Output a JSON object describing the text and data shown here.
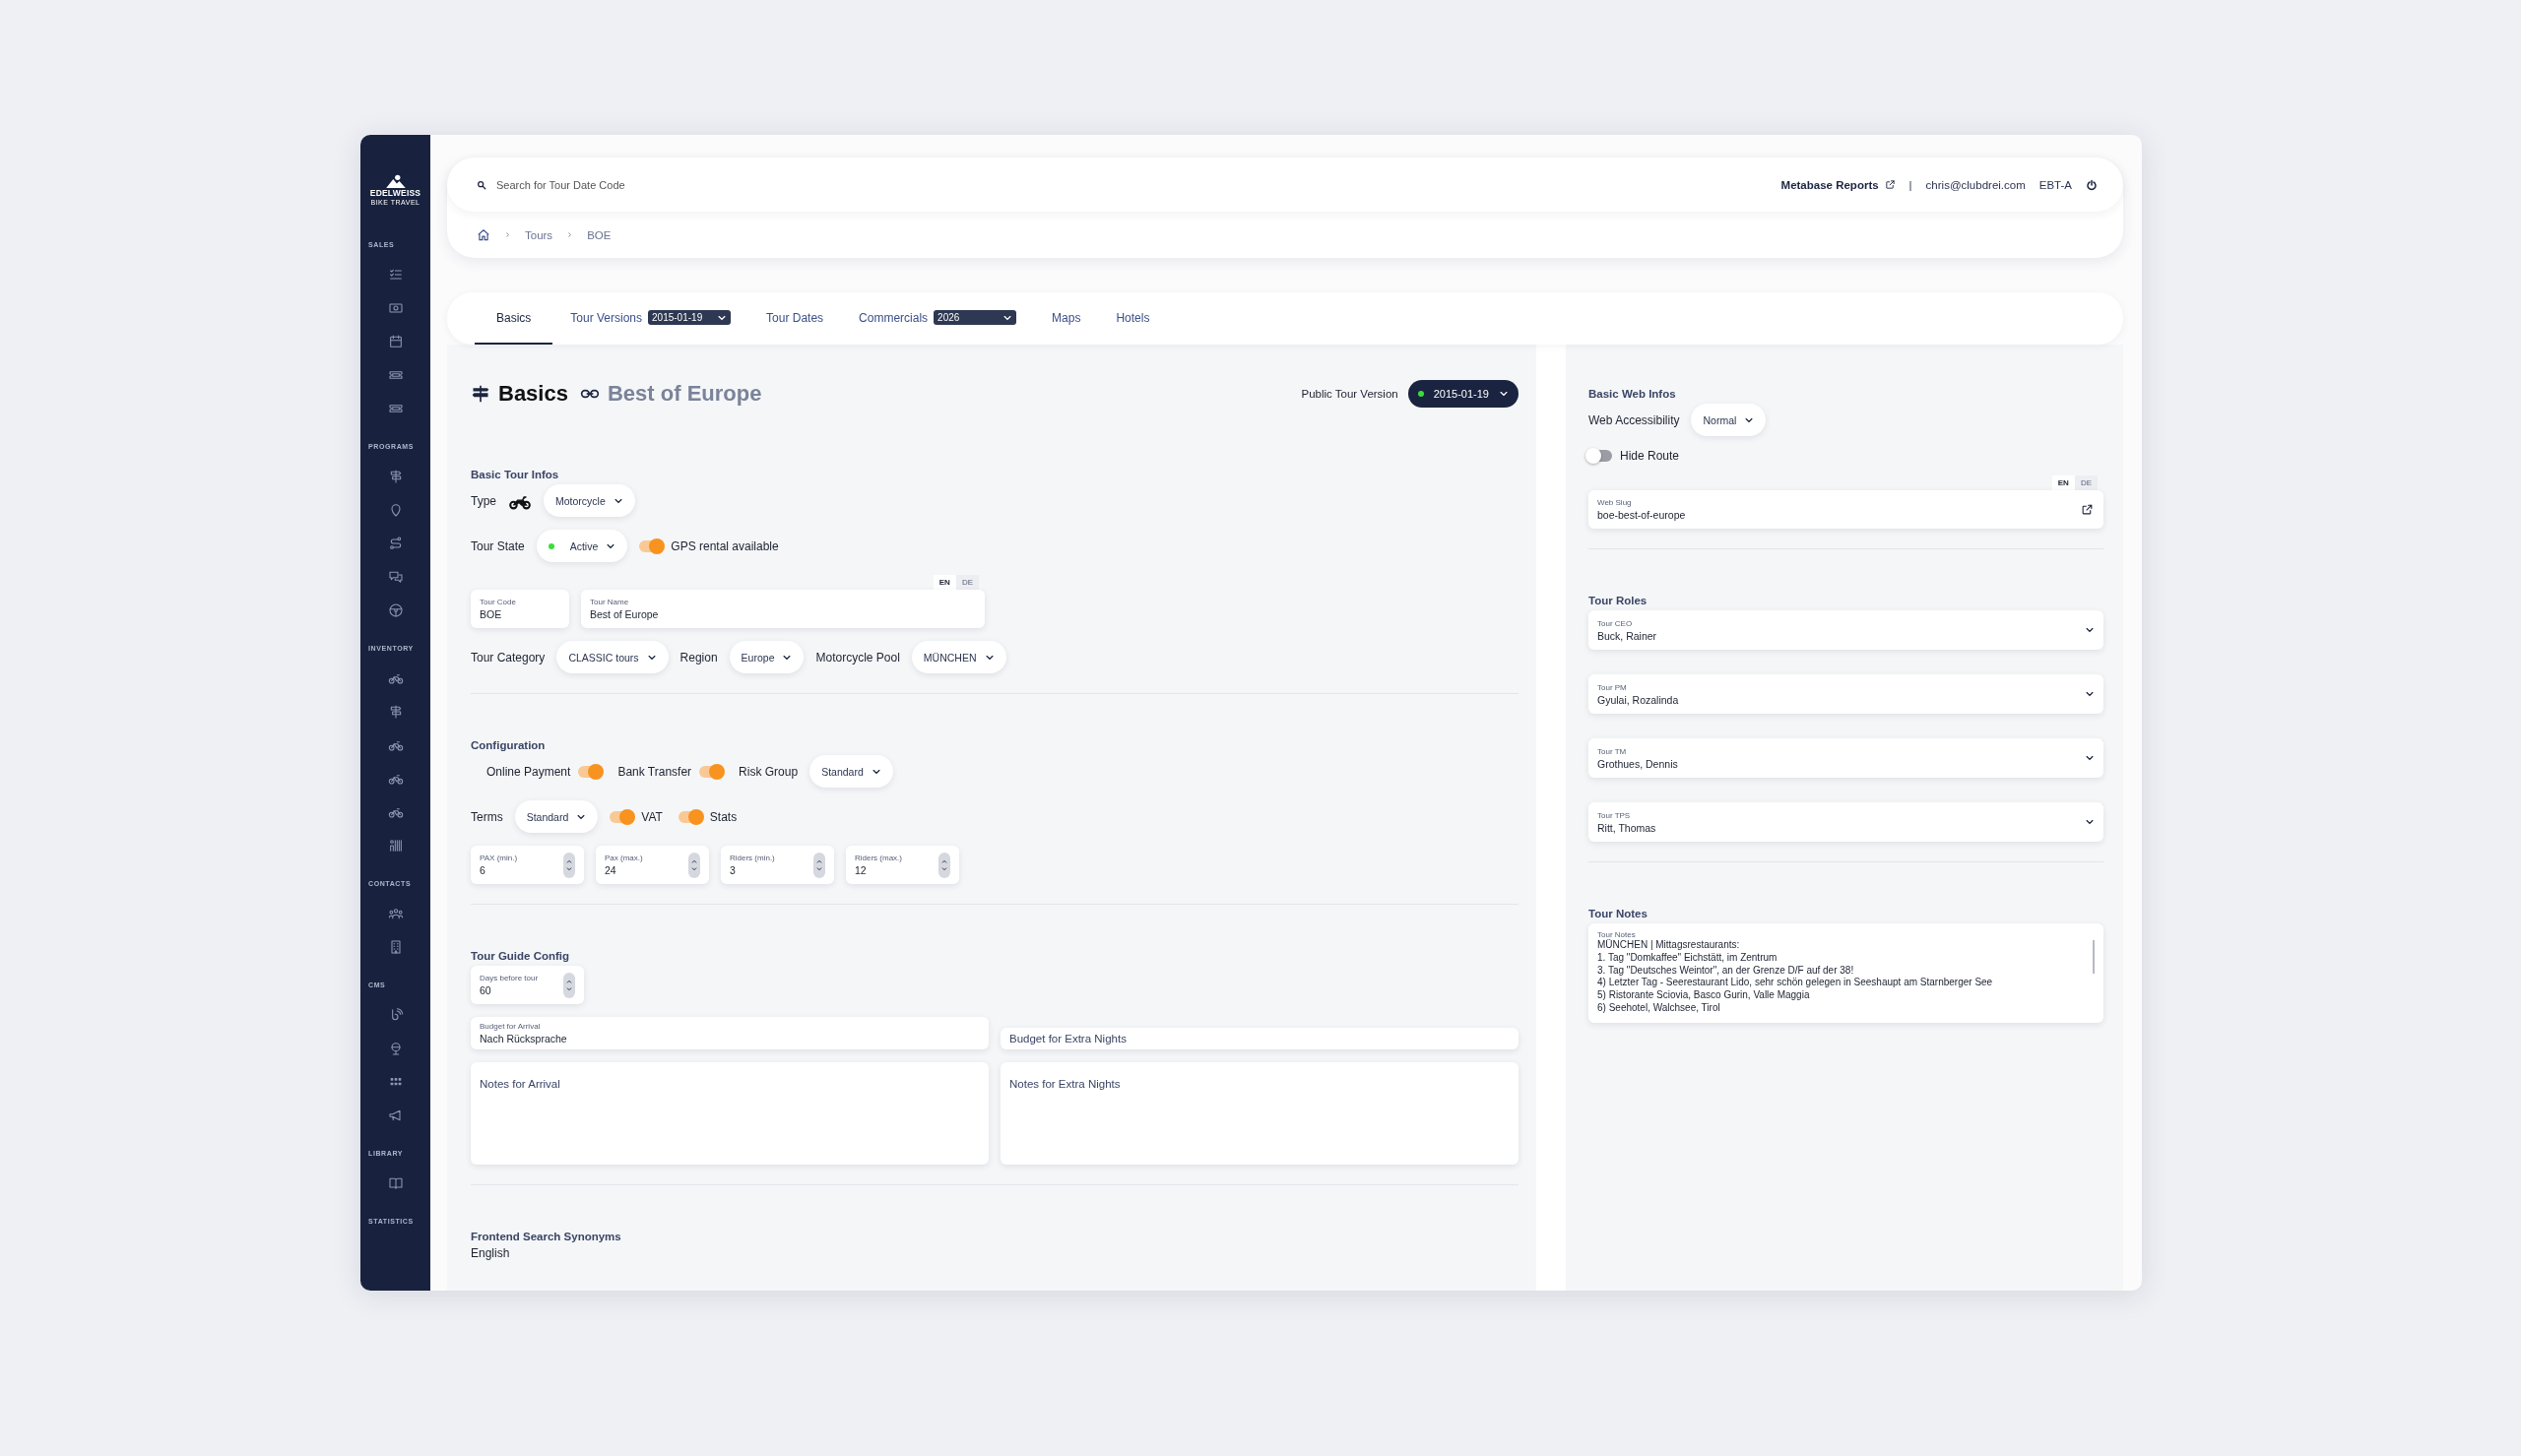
{
  "logo": {
    "name": "EDELWEISS",
    "tagline": "BIKE TRAVEL"
  },
  "sidebar": {
    "sections": [
      {
        "label": "SALES",
        "items": [
          {
            "kind": "checklist",
            "selected": false
          },
          {
            "kind": "banknote",
            "selected": false
          },
          {
            "kind": "calendar",
            "selected": false
          },
          {
            "kind": "ticket",
            "selected": false
          },
          {
            "kind": "ticket",
            "selected": false
          }
        ]
      },
      {
        "label": "PROGRAMS",
        "items": [
          {
            "kind": "signpost",
            "selected": false
          },
          {
            "kind": "pin",
            "selected": false
          },
          {
            "kind": "route",
            "selected": false
          },
          {
            "kind": "chat",
            "selected": false
          },
          {
            "kind": "wheel",
            "selected": false
          }
        ]
      },
      {
        "label": "INVENTORY",
        "items": [
          {
            "kind": "bike",
            "selected": false
          },
          {
            "kind": "signpost",
            "selected": false
          },
          {
            "kind": "bike",
            "selected": false
          },
          {
            "kind": "bike",
            "selected": false
          },
          {
            "kind": "bike",
            "selected": false
          },
          {
            "kind": "storage",
            "selected": false
          }
        ]
      },
      {
        "label": "CONTACTS",
        "items": [
          {
            "kind": "people",
            "selected": false
          },
          {
            "kind": "building",
            "selected": false
          }
        ]
      },
      {
        "label": "CMS",
        "items": [
          {
            "kind": "tag",
            "selected": false
          },
          {
            "kind": "globe",
            "selected": false
          },
          {
            "kind": "grid",
            "selected": false
          },
          {
            "kind": "megaphone",
            "selected": false
          }
        ]
      },
      {
        "label": "LIBRARY",
        "items": [
          {
            "kind": "book",
            "selected": false
          }
        ]
      },
      {
        "label": "STATISTICS"
      }
    ]
  },
  "topbar": {
    "search": {
      "placeholder": "Search for Tour Date Code"
    },
    "reports_link": "Metabase Reports",
    "separator": "|",
    "user": "chris@clubdrei.com",
    "tenant": "EBT-A"
  },
  "breadcrumb": [
    "Tours",
    "BOE"
  ],
  "tabs": [
    {
      "label": "Basics",
      "selected": true
    },
    {
      "label": "Tour Versions",
      "selected": false,
      "dropdown": "2015-01-19"
    },
    {
      "label": "Tour Dates",
      "selected": false
    },
    {
      "label": "Commercials",
      "selected": false,
      "dropdown": "2026"
    },
    {
      "label": "Maps",
      "selected": false
    },
    {
      "label": "Hotels",
      "selected": false
    }
  ],
  "header": {
    "title": "Basics",
    "subtitle": "Best of Europe",
    "public_version": {
      "label": "Public Tour Version",
      "value": "2015-01-19",
      "color": "#3ddc3d"
    }
  },
  "left": {
    "sections": [
      {
        "title": "Basic Tour Infos",
        "rows": [
          {
            "items": [
              {
                "kind": "label",
                "text": "Type"
              },
              {
                "kind": "motorcycle"
              },
              {
                "kind": "select",
                "value": "Motorcycle"
              }
            ]
          },
          {
            "items": [
              {
                "kind": "label",
                "text": "Tour State"
              },
              {
                "kind": "select",
                "value": "Active",
                "color": "#3ddc3d"
              },
              {
                "kind": "toggle",
                "label": "GPS rental available",
                "on": true,
                "label_first": false
              }
            ]
          },
          {
            "items": [
              {
                "kind": "field",
                "label": "Tour Code",
                "value": "BOE"
              },
              {
                "kind": "field_wide",
                "label": "Tour Name",
                "value": "Best of Europe",
                "langs": [
                  {
                    "label": "EN",
                    "selected": true
                  },
                  {
                    "label": "DE",
                    "selected": false
                  }
                ]
              }
            ]
          },
          {
            "items": [
              {
                "kind": "label",
                "text": "Tour Category"
              },
              {
                "kind": "select",
                "value": "CLASSIC tours"
              },
              {
                "kind": "label",
                "text": "Region"
              },
              {
                "kind": "select",
                "value": "Europe"
              },
              {
                "kind": "label",
                "text": "Motorcycle Pool"
              },
              {
                "kind": "select",
                "value": "MÜNCHEN"
              }
            ]
          }
        ]
      },
      {
        "title": "Configuration",
        "rows": [
          {
            "items": [
              {
                "kind": "toggle",
                "label": "Online Payment",
                "on": true,
                "label_first": true
              },
              {
                "kind": "toggle",
                "label": "Bank Transfer",
                "on": true,
                "label_first": true
              },
              {
                "kind": "label",
                "text": "Risk Group"
              },
              {
                "kind": "select",
                "value": "Standard"
              }
            ]
          },
          {
            "items": [
              {
                "kind": "label",
                "text": "Terms"
              },
              {
                "kind": "select",
                "value": "Standard"
              },
              {
                "kind": "toggle",
                "label": "VAT",
                "on": true,
                "label_first": false
              },
              {
                "kind": "toggle",
                "label": "Stats",
                "on": true,
                "label_first": false
              }
            ]
          },
          {
            "items": [
              {
                "kind": "number",
                "label": "PAX (min.)",
                "value": "6"
              },
              {
                "kind": "number",
                "label": "Pax (max.)",
                "value": "24"
              },
              {
                "kind": "number",
                "label": "Riders (min.)",
                "value": "3"
              },
              {
                "kind": "number",
                "label": "Riders (max.)",
                "value": "12"
              }
            ]
          }
        ]
      },
      {
        "title": "Tour Guide Config",
        "rows": [
          {
            "items": [
              {
                "kind": "number",
                "label": "Days before tour",
                "value": "60"
              }
            ]
          },
          {
            "items": [
              {
                "kind": "field_half",
                "label": "Budget for Arrival",
                "value": "Nach Rücksprache"
              },
              {
                "kind": "field_half",
                "placeholder": "Budget for Extra Nights"
              }
            ]
          },
          {
            "items": [
              {
                "kind": "textarea",
                "placeholder": "Notes for Arrival"
              },
              {
                "kind": "textarea",
                "placeholder": "Notes for Extra Nights"
              }
            ]
          }
        ]
      },
      {
        "title": "Frontend Search Synonyms",
        "rows": [
          {
            "items": [
              {
                "kind": "label",
                "text": "English"
              }
            ]
          }
        ]
      }
    ]
  },
  "right": {
    "sections": [
      {
        "title": "Basic Web Infos",
        "rows": [
          {
            "items": [
              {
                "kind": "label",
                "text": "Web Accessibility"
              },
              {
                "kind": "select",
                "value": "Normal"
              }
            ]
          },
          {
            "items": [
              {
                "kind": "toggle",
                "label": "Hide Route",
                "on": false,
                "label_first": false
              }
            ]
          },
          {
            "items": [
              {
                "kind": "field_link",
                "label": "Web Slug",
                "value": "boe-best-of-europe",
                "langs": [
                  {
                    "label": "EN",
                    "selected": true
                  },
                  {
                    "label": "DE",
                    "selected": false
                  }
                ]
              }
            ]
          }
        ]
      },
      {
        "title": "Tour Roles",
        "rows": [
          {
            "items": [
              {
                "kind": "role_select",
                "label": "Tour CEO",
                "value": "Buck, Rainer"
              }
            ]
          },
          {
            "items": [
              {
                "kind": "role_select",
                "label": "Tour PM",
                "value": "Gyulai, Rozalinda"
              }
            ]
          },
          {
            "items": [
              {
                "kind": "role_select",
                "label": "Tour TM",
                "value": "Grothues, Dennis"
              }
            ]
          },
          {
            "items": [
              {
                "kind": "role_select",
                "label": "Tour TPS",
                "value": "Ritt, Thomas"
              }
            ]
          }
        ]
      },
      {
        "title": "Tour Notes",
        "rows": [
          {
            "items": [
              {
                "kind": "notes",
                "label": "Tour Notes",
                "value": "MÜNCHEN | Mittagsrestaurants:\n1. Tag \"Domkaffee\" Eichstätt, im Zentrum\n3. Tag \"Deutsches Weintor\", an der Grenze D/F auf der 38!\n4) Letzter Tag - Seerestaurant Lido, sehr schön gelegen in Seeshaupt am Starnberger See\n5) Ristorante Sciovia, Basco Gurin, Valle Maggia\n6) Seehotel, Walchsee, Tirol"
              }
            ]
          }
        ]
      }
    ]
  }
}
